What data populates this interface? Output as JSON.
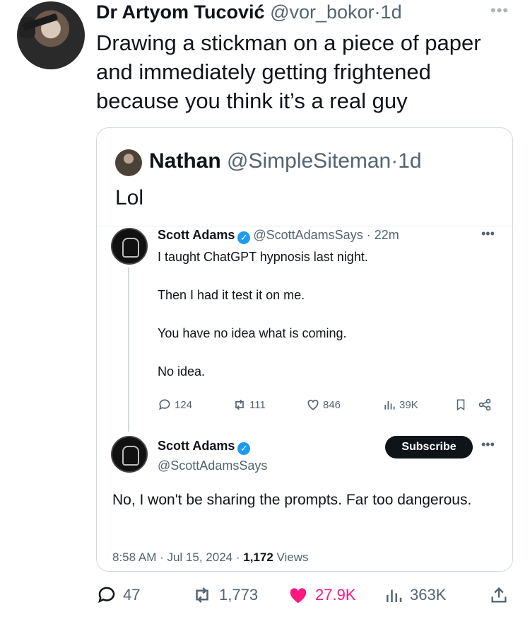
{
  "tweet": {
    "author_name": "Dr Artyom Tucović",
    "author_handle": "@vor_bokor",
    "separator": "·",
    "age": "1d",
    "text": "Drawing a stickman on a piece of paper and immediately getting frightened because you think it’s a real guy"
  },
  "quote": {
    "author_name": "Nathan",
    "author_handle": "@SimpleSiteman",
    "age": "1d",
    "text": "Lol"
  },
  "screenshot": {
    "first": {
      "author_name": "Scott Adams",
      "author_handle": "@ScottAdamsSays",
      "age": "22m",
      "lines": [
        "I taught ChatGPT hypnosis last night.",
        "Then I had it test it on me.",
        "You have no idea what is coming.",
        "No idea."
      ],
      "stats": {
        "replies": "124",
        "reposts": "111",
        "likes": "846",
        "views": "39K"
      }
    },
    "second": {
      "author_name": "Scott Adams",
      "author_handle": "@ScottAdamsSays",
      "subscribe_label": "Subscribe",
      "text": "No, I won't be sharing the prompts. Far too dangerous.",
      "timestamp": "8:58 AM · Jul 15, 2024 ·",
      "views_count": "1,172",
      "views_label": "Views"
    }
  },
  "actions": {
    "replies": "47",
    "reposts": "1,773",
    "likes": "27.9K",
    "views": "363K"
  },
  "colors": {
    "like": "#f91880",
    "verified": "#1d9bf0",
    "muted": "#536471"
  }
}
